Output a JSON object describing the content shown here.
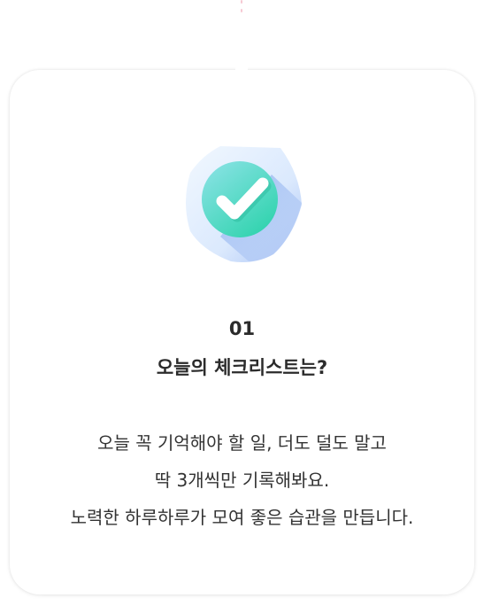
{
  "card": {
    "number": "01",
    "title": "오늘의 체크리스트는?",
    "description_lines": [
      "오늘 꼭 기억해야 할 일, 더도 덜도 말고",
      "딱 3개씩만 기록해봐요.",
      "노력한 하루하루가 모여 좋은 습관을 만듭니다."
    ]
  },
  "colors": {
    "connector": "#f6c9d3",
    "badge_light": "#e8f3ff",
    "badge_blue": "#a9c3f5",
    "check_circle": "#3ed6b8",
    "check_circle_light": "#8fe3e8",
    "title_text": "#2b2b2b",
    "body_text": "#333333"
  },
  "icons": {
    "badge": "shield-check-icon"
  }
}
